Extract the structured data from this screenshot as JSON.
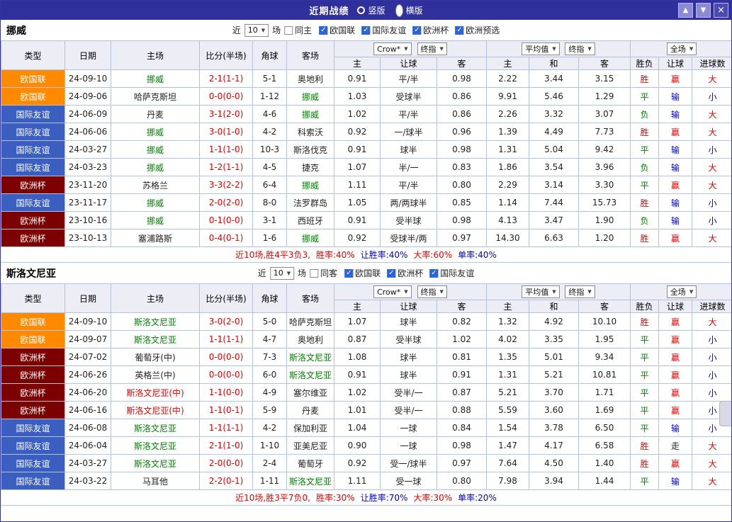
{
  "titlebar": {
    "title": "近期战绩",
    "radios": [
      {
        "label": "竖版",
        "selected": false
      },
      {
        "label": "横版",
        "selected": true
      }
    ],
    "buttons": {
      "up": "▲",
      "down": "▼",
      "close": "×"
    }
  },
  "palette": {
    "titlebar_bg": "#30309c",
    "header_bg": "#ededf5",
    "grid_border": "#b3c1dc",
    "win_red": "#e60000",
    "lose_blue": "#0000cc",
    "draw_green": "#008000"
  },
  "type_colors": {
    "欧国联": "#ff8a00",
    "国际友谊": "#3a5fc0",
    "欧洲杯": "#7d0000"
  },
  "sections": [
    {
      "team": "挪威",
      "filters": {
        "recent_label": "近",
        "count": "10",
        "unit_label": "场",
        "venue": {
          "label": "同主",
          "checked": false
        },
        "competitions": [
          {
            "label": "欧国联",
            "checked": true
          },
          {
            "label": "国际友谊",
            "checked": true
          },
          {
            "label": "欧洲杯",
            "checked": true
          },
          {
            "label": "欧洲预选",
            "checked": true
          }
        ]
      },
      "header": {
        "type": "类型",
        "date": "日期",
        "home": "主场",
        "score": "比分(半场)",
        "corner": "角球",
        "away": "客场",
        "odds_company": "Crow*",
        "odds_company_kind": "终指",
        "odds_avg": "平均值",
        "odds_avg_kind": "终指",
        "scope": "全场",
        "sub": [
          "主",
          "让球",
          "客",
          "主",
          "和",
          "客",
          "胜负",
          "让球",
          "进球数"
        ]
      },
      "rows": [
        {
          "type": "欧国联",
          "date": "24-09-10",
          "home": "挪威",
          "home_c": "green",
          "score": "2-1(1-1)",
          "corner": "5-1",
          "away": "奥地利",
          "away_c": "dark",
          "odds": [
            "0.91",
            "平/半",
            "0.98"
          ],
          "avg": [
            "2.22",
            "3.44",
            "3.15"
          ],
          "results": [
            {
              "t": "胜",
              "c": "red"
            },
            {
              "t": "赢",
              "c": "red"
            },
            {
              "t": "大",
              "c": "red"
            }
          ]
        },
        {
          "type": "欧国联",
          "date": "24-09-06",
          "home": "哈萨克斯坦",
          "home_c": "dark",
          "score": "0-0(0-0)",
          "corner": "1-12",
          "away": "挪威",
          "away_c": "green",
          "odds": [
            "1.03",
            "受球半",
            "0.86"
          ],
          "avg": [
            "9.91",
            "5.46",
            "1.29"
          ],
          "results": [
            {
              "t": "平",
              "c": "green"
            },
            {
              "t": "输",
              "c": "blue"
            },
            {
              "t": "小",
              "c": "blue"
            }
          ]
        },
        {
          "type": "国际友谊",
          "date": "24-06-09",
          "home": "丹麦",
          "home_c": "dark",
          "score": "3-1(2-0)",
          "corner": "4-6",
          "away": "挪威",
          "away_c": "green",
          "odds": [
            "1.02",
            "平/半",
            "0.86"
          ],
          "avg": [
            "2.26",
            "3.32",
            "3.07"
          ],
          "results": [
            {
              "t": "负",
              "c": "green"
            },
            {
              "t": "输",
              "c": "blue"
            },
            {
              "t": "大",
              "c": "red"
            }
          ]
        },
        {
          "type": "国际友谊",
          "date": "24-06-06",
          "home": "挪威",
          "home_c": "green",
          "score": "3-0(1-0)",
          "corner": "4-2",
          "away": "科索沃",
          "away_c": "dark",
          "odds": [
            "0.92",
            "一/球半",
            "0.96"
          ],
          "avg": [
            "1.39",
            "4.49",
            "7.73"
          ],
          "results": [
            {
              "t": "胜",
              "c": "red"
            },
            {
              "t": "赢",
              "c": "red"
            },
            {
              "t": "大",
              "c": "red"
            }
          ]
        },
        {
          "type": "国际友谊",
          "date": "24-03-27",
          "home": "挪威",
          "home_c": "green",
          "score": "1-1(1-0)",
          "corner": "10-3",
          "away": "斯洛伐克",
          "away_c": "dark",
          "odds": [
            "0.91",
            "球半",
            "0.98"
          ],
          "avg": [
            "1.31",
            "5.04",
            "9.42"
          ],
          "results": [
            {
              "t": "平",
              "c": "green"
            },
            {
              "t": "输",
              "c": "blue"
            },
            {
              "t": "小",
              "c": "blue"
            }
          ]
        },
        {
          "type": "国际友谊",
          "date": "24-03-23",
          "home": "挪威",
          "home_c": "green",
          "score": "1-2(1-1)",
          "corner": "4-5",
          "away": "捷克",
          "away_c": "dark",
          "odds": [
            "1.07",
            "半/一",
            "0.83"
          ],
          "avg": [
            "1.86",
            "3.54",
            "3.96"
          ],
          "results": [
            {
              "t": "负",
              "c": "green"
            },
            {
              "t": "输",
              "c": "blue"
            },
            {
              "t": "大",
              "c": "red"
            }
          ]
        },
        {
          "type": "欧洲杯",
          "date": "23-11-20",
          "home": "苏格兰",
          "home_c": "dark",
          "score": "3-3(2-2)",
          "corner": "6-4",
          "away": "挪威",
          "away_c": "green",
          "odds": [
            "1.11",
            "平/半",
            "0.80"
          ],
          "avg": [
            "2.29",
            "3.14",
            "3.30"
          ],
          "results": [
            {
              "t": "平",
              "c": "green"
            },
            {
              "t": "赢",
              "c": "red"
            },
            {
              "t": "大",
              "c": "red"
            }
          ]
        },
        {
          "type": "国际友谊",
          "date": "23-11-17",
          "home": "挪威",
          "home_c": "green",
          "score": "2-0(2-0)",
          "corner": "8-0",
          "away": "法罗群岛",
          "away_c": "dark",
          "odds": [
            "1.05",
            "两/两球半",
            "0.85"
          ],
          "avg": [
            "1.14",
            "7.44",
            "15.73"
          ],
          "results": [
            {
              "t": "胜",
              "c": "red"
            },
            {
              "t": "输",
              "c": "blue"
            },
            {
              "t": "小",
              "c": "blue"
            }
          ]
        },
        {
          "type": "欧洲杯",
          "date": "23-10-16",
          "home": "挪威",
          "home_c": "green",
          "score": "0-1(0-0)",
          "corner": "3-1",
          "away": "西班牙",
          "away_c": "dark",
          "odds": [
            "0.91",
            "受半球",
            "0.98"
          ],
          "avg": [
            "4.13",
            "3.47",
            "1.90"
          ],
          "results": [
            {
              "t": "负",
              "c": "green"
            },
            {
              "t": "输",
              "c": "blue"
            },
            {
              "t": "小",
              "c": "blue"
            }
          ]
        },
        {
          "type": "欧洲杯",
          "date": "23-10-13",
          "home": "塞浦路斯",
          "home_c": "dark",
          "score": "0-4(0-1)",
          "corner": "1-6",
          "away": "挪威",
          "away_c": "green",
          "odds": [
            "0.92",
            "受球半/两",
            "0.97"
          ],
          "avg": [
            "14.30",
            "6.63",
            "1.20"
          ],
          "results": [
            {
              "t": "胜",
              "c": "red"
            },
            {
              "t": "赢",
              "c": "red"
            },
            {
              "t": "大",
              "c": "red"
            }
          ]
        }
      ],
      "summary": [
        {
          "t": "近10场,胜4平3负3,",
          "c": "red"
        },
        {
          "t": "胜率:40%",
          "c": "red"
        },
        {
          "t": "让胜率:40%",
          "c": "blue"
        },
        {
          "t": "大率:60%",
          "c": "red"
        },
        {
          "t": "单率:40%",
          "c": "blue"
        }
      ]
    },
    {
      "team": "斯洛文尼亚",
      "filters": {
        "recent_label": "近",
        "count": "10",
        "unit_label": "场",
        "venue": {
          "label": "同客",
          "checked": false
        },
        "competitions": [
          {
            "label": "欧国联",
            "checked": true
          },
          {
            "label": "欧洲杯",
            "checked": true
          },
          {
            "label": "国际友谊",
            "checked": true
          }
        ]
      },
      "header": {
        "type": "类型",
        "date": "日期",
        "home": "主场",
        "score": "比分(半场)",
        "corner": "角球",
        "away": "客场",
        "odds_company": "Crow*",
        "odds_company_kind": "终指",
        "odds_avg": "平均值",
        "odds_avg_kind": "终指",
        "scope": "全场",
        "sub": [
          "主",
          "让球",
          "客",
          "主",
          "和",
          "客",
          "胜负",
          "让球",
          "进球数"
        ]
      },
      "rows": [
        {
          "type": "欧国联",
          "date": "24-09-10",
          "home": "斯洛文尼亚",
          "home_c": "green",
          "score": "3-0(2-0)",
          "corner": "5-0",
          "away": "哈萨克斯坦",
          "away_c": "dark",
          "odds": [
            "1.07",
            "球半",
            "0.82"
          ],
          "avg": [
            "1.32",
            "4.92",
            "10.10"
          ],
          "results": [
            {
              "t": "胜",
              "c": "red"
            },
            {
              "t": "赢",
              "c": "red"
            },
            {
              "t": "大",
              "c": "red"
            }
          ]
        },
        {
          "type": "欧国联",
          "date": "24-09-07",
          "home": "斯洛文尼亚",
          "home_c": "green",
          "score": "1-1(1-1)",
          "corner": "4-7",
          "away": "奥地利",
          "away_c": "dark",
          "odds": [
            "0.87",
            "受半球",
            "1.02"
          ],
          "avg": [
            "4.02",
            "3.35",
            "1.95"
          ],
          "results": [
            {
              "t": "平",
              "c": "green"
            },
            {
              "t": "赢",
              "c": "red"
            },
            {
              "t": "小",
              "c": "blue"
            }
          ]
        },
        {
          "type": "欧洲杯",
          "date": "24-07-02",
          "home": "葡萄牙(中)",
          "home_c": "dark",
          "score": "0-0(0-0)",
          "corner": "7-3",
          "away": "斯洛文尼亚",
          "away_c": "green",
          "odds": [
            "1.08",
            "球半",
            "0.81"
          ],
          "avg": [
            "1.35",
            "5.01",
            "9.34"
          ],
          "results": [
            {
              "t": "平",
              "c": "green"
            },
            {
              "t": "赢",
              "c": "red"
            },
            {
              "t": "小",
              "c": "blue"
            }
          ]
        },
        {
          "type": "欧洲杯",
          "date": "24-06-26",
          "home": "英格兰(中)",
          "home_c": "dark",
          "score": "0-0(0-0)",
          "corner": "6-0",
          "away": "斯洛文尼亚",
          "away_c": "green",
          "odds": [
            "0.91",
            "球半",
            "0.91"
          ],
          "avg": [
            "1.31",
            "5.21",
            "10.81"
          ],
          "results": [
            {
              "t": "平",
              "c": "green"
            },
            {
              "t": "赢",
              "c": "red"
            },
            {
              "t": "小",
              "c": "blue"
            }
          ]
        },
        {
          "type": "欧洲杯",
          "date": "24-06-20",
          "home": "斯洛文尼亚(中)",
          "home_c": "red",
          "score": "1-1(0-0)",
          "corner": "4-9",
          "away": "塞尔维亚",
          "away_c": "dark",
          "odds": [
            "1.02",
            "受半/一",
            "0.87"
          ],
          "avg": [
            "5.21",
            "3.70",
            "1.71"
          ],
          "results": [
            {
              "t": "平",
              "c": "green"
            },
            {
              "t": "赢",
              "c": "red"
            },
            {
              "t": "小",
              "c": "blue"
            }
          ]
        },
        {
          "type": "欧洲杯",
          "date": "24-06-16",
          "home": "斯洛文尼亚(中)",
          "home_c": "red",
          "score": "1-1(0-1)",
          "corner": "5-9",
          "away": "丹麦",
          "away_c": "dark",
          "odds": [
            "1.01",
            "受半/一",
            "0.88"
          ],
          "avg": [
            "5.59",
            "3.60",
            "1.69"
          ],
          "results": [
            {
              "t": "平",
              "c": "green"
            },
            {
              "t": "赢",
              "c": "red"
            },
            {
              "t": "小",
              "c": "blue"
            }
          ]
        },
        {
          "type": "国际友谊",
          "date": "24-06-08",
          "home": "斯洛文尼亚",
          "home_c": "green",
          "score": "1-1(1-1)",
          "corner": "4-2",
          "away": "保加利亚",
          "away_c": "dark",
          "odds": [
            "1.04",
            "一球",
            "0.84"
          ],
          "avg": [
            "1.54",
            "3.78",
            "6.50"
          ],
          "results": [
            {
              "t": "平",
              "c": "green"
            },
            {
              "t": "输",
              "c": "blue"
            },
            {
              "t": "小",
              "c": "blue"
            }
          ]
        },
        {
          "type": "国际友谊",
          "date": "24-06-04",
          "home": "斯洛文尼亚",
          "home_c": "green",
          "score": "2-1(1-0)",
          "corner": "1-10",
          "away": "亚美尼亚",
          "away_c": "dark",
          "odds": [
            "0.90",
            "一球",
            "0.98"
          ],
          "avg": [
            "1.47",
            "4.17",
            "6.58"
          ],
          "results": [
            {
              "t": "胜",
              "c": "red"
            },
            {
              "t": "走",
              "c": "dark"
            },
            {
              "t": "大",
              "c": "red"
            }
          ]
        },
        {
          "type": "国际友谊",
          "date": "24-03-27",
          "home": "斯洛文尼亚",
          "home_c": "green",
          "score": "2-0(0-0)",
          "corner": "2-4",
          "away": "葡萄牙",
          "away_c": "dark",
          "odds": [
            "0.92",
            "受一/球半",
            "0.97"
          ],
          "avg": [
            "7.64",
            "4.50",
            "1.40"
          ],
          "results": [
            {
              "t": "胜",
              "c": "red"
            },
            {
              "t": "赢",
              "c": "red"
            },
            {
              "t": "大",
              "c": "red"
            }
          ]
        },
        {
          "type": "国际友谊",
          "date": "24-03-22",
          "home": "马耳他",
          "home_c": "dark",
          "score": "2-2(0-1)",
          "corner": "1-11",
          "away": "斯洛文尼亚",
          "away_c": "green",
          "odds": [
            "1.11",
            "受一球",
            "0.80"
          ],
          "avg": [
            "7.98",
            "3.94",
            "1.44"
          ],
          "results": [
            {
              "t": "平",
              "c": "green"
            },
            {
              "t": "输",
              "c": "blue"
            },
            {
              "t": "大",
              "c": "red"
            }
          ]
        }
      ],
      "summary": [
        {
          "t": "近10场,胜3平7负0,",
          "c": "red"
        },
        {
          "t": "胜率:30%",
          "c": "red"
        },
        {
          "t": "让胜率:70%",
          "c": "blue"
        },
        {
          "t": "大率:30%",
          "c": "red"
        },
        {
          "t": "单率:20%",
          "c": "blue"
        }
      ]
    }
  ]
}
